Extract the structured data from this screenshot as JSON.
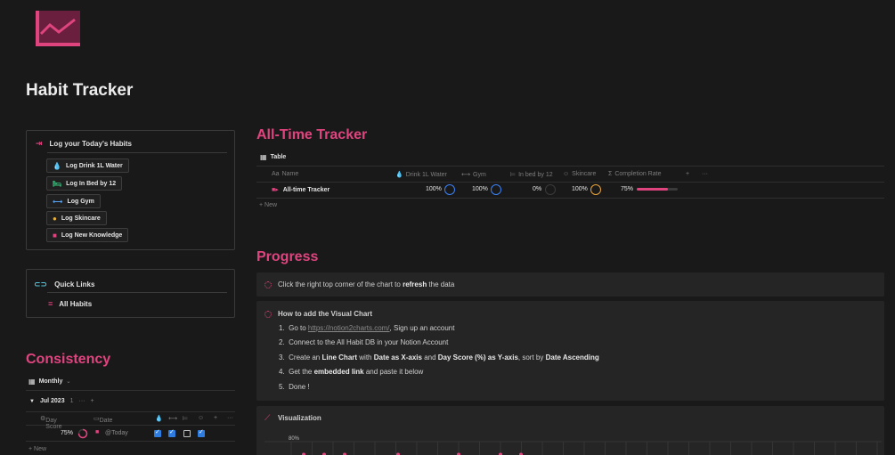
{
  "page": {
    "title": "Habit Tracker",
    "icon": "line-chart-icon",
    "accent": "#e0447f"
  },
  "log_box": {
    "title": "Log your Today's Habits",
    "buttons": [
      {
        "label": "Log Drink 1L Water",
        "icon": "water-drop-icon"
      },
      {
        "label": "Log In Bed by 12",
        "icon": "bed-icon"
      },
      {
        "label": "Log Gym",
        "icon": "dumbbell-icon"
      },
      {
        "label": "Log Skincare",
        "icon": "face-icon"
      },
      {
        "label": "Log New Knowledge",
        "icon": "book-icon"
      }
    ]
  },
  "quick_links": {
    "title": "Quick Links",
    "items": [
      {
        "label": "All Habits",
        "icon": "database-icon"
      }
    ]
  },
  "consistency": {
    "title": "Consistency",
    "view": "Monthly",
    "group": {
      "label": "Jul 2023",
      "count": "1",
      "more": "···",
      "add": "+"
    },
    "columns": {
      "day_score": "Day Score",
      "date": "Date",
      "add": "+",
      "more": "···"
    },
    "row": {
      "score": "75%",
      "date": "@Today",
      "checks": [
        true,
        true,
        false,
        true
      ]
    },
    "new": "+ New"
  },
  "all_time": {
    "title": "All-Time Tracker",
    "view": "Table",
    "columns": {
      "name": "Name",
      "water": "Drink 1L Water",
      "gym": "Gym",
      "bed": "In bed by 12",
      "skincare": "Skincare",
      "completion": "Completion Rate",
      "add": "+",
      "more": "···"
    },
    "row": {
      "name": "All-time Tracker",
      "water": "100%",
      "gym": "100%",
      "bed": "0%",
      "skincare": "100%",
      "completion": "75%",
      "completion_value": 0.75
    },
    "new": "+ New"
  },
  "progress": {
    "title": "Progress",
    "callout1": {
      "pre": "Click the right top corner of the chart to ",
      "bold": "refresh",
      "post": " the data"
    },
    "howto": {
      "title": "How to add the Visual Chart",
      "steps": {
        "s1_num": "1.",
        "s1_pre": "Go to ",
        "s1_link": "https://notion2charts.com/",
        "s1_post": ", Sign up an account",
        "s2_num": "2.",
        "s2": "Connect to the All Habit DB in your Notion Account",
        "s3_num": "3.",
        "s3_a": "Create an ",
        "s3_b": "Line Chart",
        "s3_c": " with ",
        "s3_d": "Date as X-axis",
        "s3_e": " and ",
        "s3_f": "Day Score (%) as Y-axis",
        "s3_g": ", sort by ",
        "s3_h": "Date Ascending",
        "s4_num": "4.",
        "s4_a": "Get the ",
        "s4_b": "embedded link",
        "s4_c": " and paste it below",
        "s5_num": "5.",
        "s5": "Done !"
      }
    },
    "visualization": {
      "title": "Visualization",
      "y_label": "80%"
    }
  }
}
